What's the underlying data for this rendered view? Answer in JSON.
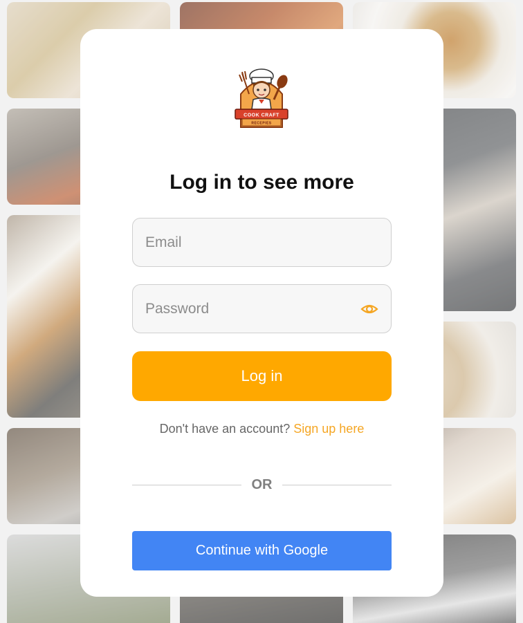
{
  "brand": {
    "logo_text_top": "COOK CRAFT",
    "logo_text_bottom": "RECEPIES",
    "accent_color": "#ffa800",
    "link_color": "#f5a623",
    "google_color": "#4285f4"
  },
  "modal": {
    "title": "Log in to see more",
    "email_placeholder": "Email",
    "password_placeholder": "Password",
    "show_password_icon": "eye-icon",
    "login_label": "Log in",
    "signup_prompt": "Don't have an account?",
    "signup_link": "Sign up here",
    "divider_label": "OR",
    "google_label": "Continue with Google"
  }
}
